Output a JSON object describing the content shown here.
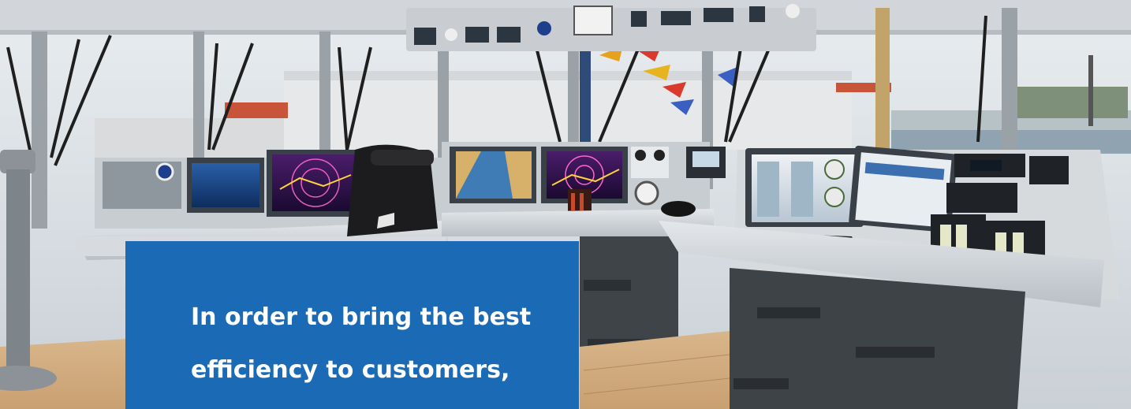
{
  "banner": {
    "image_subject": "ship-bridge-navigation-console",
    "caption_lines": [
      "In order to bring the best",
      "efficiency to customers,"
    ],
    "colors": {
      "caption_background": "#1a6ab5",
      "caption_text": "#ffffff"
    }
  }
}
